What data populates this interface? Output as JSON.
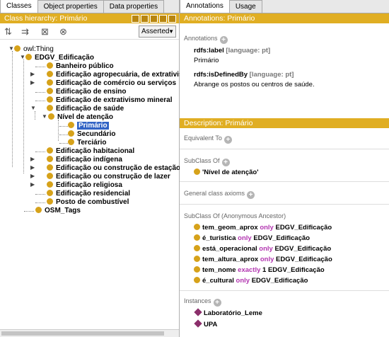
{
  "left_tabs": [
    "Classes",
    "Object properties",
    "Data properties"
  ],
  "class_hierarchy": {
    "title": "Class hierarchy: Primário",
    "asserted": "Asserted"
  },
  "tree": {
    "root": "owl:Thing",
    "edgv": "EDGV_Edificação",
    "children": [
      "Banheiro público",
      "Edificação agropecuária, de extrativismo",
      "Edificação de comércio ou serviços",
      "Edificação de ensino",
      "Edificação de extrativismo mineral",
      "Edificação de saúde"
    ],
    "nivel": "Nível de atenção",
    "nivel_children": [
      "Primário",
      "Secundário",
      "Terciário"
    ],
    "after": [
      "Edificação habitacional",
      "Edificação indígena",
      "Edificação ou construção de estação de",
      "Edificação ou construção de lazer",
      "Edificação religiosa",
      "Edificação residencial",
      "Posto de combustível"
    ],
    "osm": "OSM_Tags"
  },
  "right_tabs": [
    "Annotations",
    "Usage"
  ],
  "annotations": {
    "title": "Annotations: Primário",
    "section": "Annotations",
    "label_key": "rdfs:label",
    "label_lang": "[language: pt]",
    "label_value": "Primário",
    "defined_key": "rdfs:isDefinedBy",
    "defined_lang": "[language: pt]",
    "defined_value": "Abrange os postos ou centros de saúde."
  },
  "description": {
    "title": "Description: Primário",
    "equivalent": "Equivalent To",
    "subclass": "SubClass Of",
    "subclass_item": "'Nível de atenção'",
    "axioms": "General class axioms",
    "anon": "SubClass Of (Anonymous Ancestor)",
    "restrictions": [
      {
        "prop": "tem_geom_aprox",
        "kw": "only",
        "rest": "EDGV_Edificação"
      },
      {
        "prop": "é_turistica",
        "kw": "only",
        "rest": "EDGV_Edificação"
      },
      {
        "prop": "está_operacional",
        "kw": "only",
        "rest": "EDGV_Edificação"
      },
      {
        "prop": "tem_altura_aprox",
        "kw": "only",
        "rest": "EDGV_Edificação"
      },
      {
        "prop": "tem_nome",
        "kw": "exactly",
        "rest": "1 EDGV_Edificação"
      },
      {
        "prop": "é_cultural",
        "kw": "only",
        "rest": "EDGV_Edificação"
      }
    ],
    "instances": "Instances",
    "instance_items": [
      "Laboratório_Leme",
      "UPA"
    ]
  }
}
